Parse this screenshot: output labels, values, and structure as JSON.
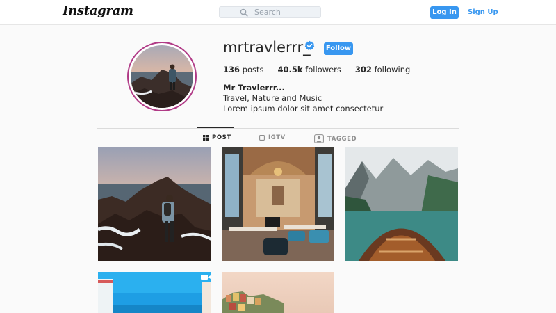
{
  "header": {
    "logo": "Instagram",
    "search_placeholder": "Search",
    "login_label": "Log In",
    "signup_label": "Sign Up"
  },
  "profile": {
    "username": "mrtravlerrr_",
    "verified": true,
    "follow_label": "Follow",
    "posts_count": "136",
    "posts_label": "posts",
    "followers_count": "40.5k",
    "followers_label": "followers",
    "following_count": "302",
    "following_label": "following",
    "full_name": "Mr Travlerrr...",
    "bio_line1": "Travel, Nature and Music",
    "bio_line2": "Lorem ipsum dolor sit amet consectetur"
  },
  "tabs": [
    {
      "label": "POST",
      "icon": "grid-icon",
      "active": true
    },
    {
      "label": "IGTV",
      "icon": "tv-icon",
      "active": false
    },
    {
      "label": "TAGGED",
      "icon": "tagged-user-icon",
      "active": false
    }
  ],
  "colors": {
    "accent": "#3897f0",
    "avatar_ring": "#b03a86",
    "verified_badge": "#3897f0"
  }
}
